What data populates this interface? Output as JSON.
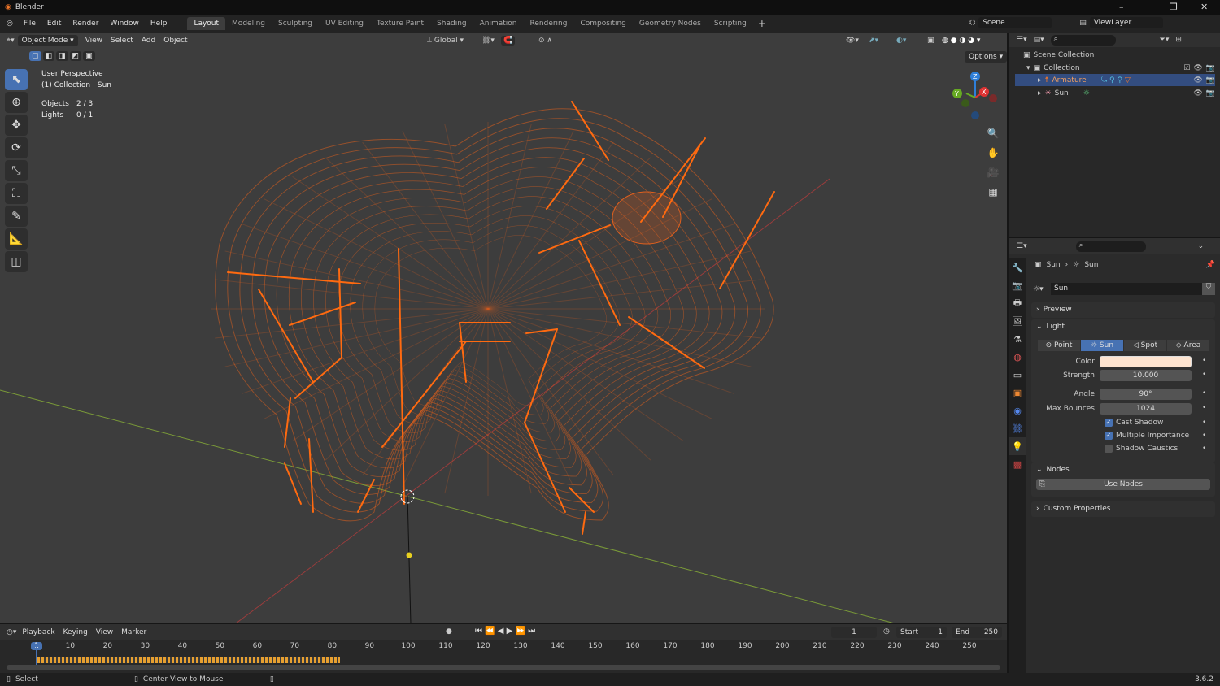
{
  "app": {
    "title": "Blender",
    "version": "3.6.2"
  },
  "menu": [
    "File",
    "Edit",
    "Render",
    "Window",
    "Help"
  ],
  "workspaces": [
    "Layout",
    "Modeling",
    "Sculpting",
    "UV Editing",
    "Texture Paint",
    "Shading",
    "Animation",
    "Rendering",
    "Compositing",
    "Geometry Nodes",
    "Scripting"
  ],
  "active_workspace": "Layout",
  "scene": "Scene",
  "view_layer": "ViewLayer",
  "viewport": {
    "mode": "Object Mode",
    "menus": [
      "View",
      "Select",
      "Add",
      "Object"
    ],
    "transform": "Global",
    "options": "Options",
    "info": {
      "perspective": "User Perspective",
      "collection": "(1) Collection | Sun",
      "objects_label": "Objects",
      "objects": "2 / 3",
      "lights_label": "Lights",
      "lights": "0 / 1"
    },
    "mesh_color": "#e0601e",
    "bone_color": "#ff6a10"
  },
  "outliner": {
    "root": "Scene Collection",
    "collection": "Collection",
    "items": [
      {
        "name": "Armature",
        "selected": true
      },
      {
        "name": "Sun",
        "selected": false
      }
    ]
  },
  "properties": {
    "breadcrumb": [
      "Sun",
      "Sun"
    ],
    "datablock": "Sun",
    "panels": {
      "preview": "Preview",
      "light": "Light",
      "nodes": "Nodes",
      "custom": "Custom Properties"
    },
    "light_types": [
      "Point",
      "Sun",
      "Spot",
      "Area"
    ],
    "active_type": "Sun",
    "color_label": "Color",
    "color": "#fde3cf",
    "strength_label": "Strength",
    "strength": "10.000",
    "angle_label": "Angle",
    "angle": "90°",
    "bounces_label": "Max Bounces",
    "bounces": "1024",
    "checks": [
      {
        "label": "Cast Shadow",
        "on": true
      },
      {
        "label": "Multiple Importance",
        "on": true
      },
      {
        "label": "Shadow Caustics",
        "on": false
      }
    ],
    "use_nodes": "Use Nodes"
  },
  "timeline": {
    "menus": [
      "Playback",
      "Keying",
      "View",
      "Marker"
    ],
    "current": "1",
    "start_label": "Start",
    "start": "1",
    "end_label": "End",
    "end": "250",
    "ticks": [
      "1",
      "10",
      "20",
      "30",
      "40",
      "50",
      "60",
      "70",
      "80",
      "90",
      "100",
      "110",
      "120",
      "130",
      "140",
      "150",
      "160",
      "170",
      "180",
      "190",
      "200",
      "210",
      "220",
      "230",
      "240",
      "250"
    ]
  },
  "status": {
    "select": "Select",
    "center": "Center View to Mouse"
  }
}
